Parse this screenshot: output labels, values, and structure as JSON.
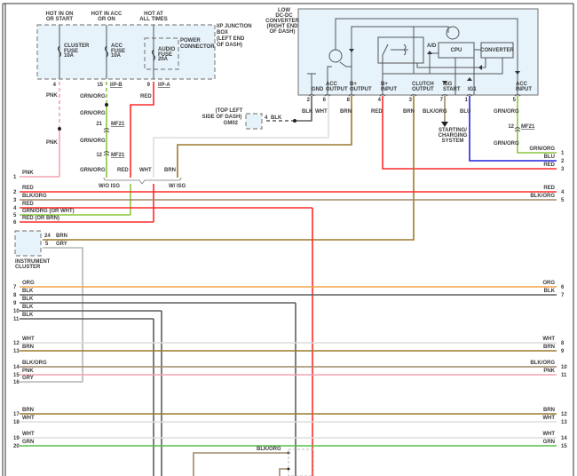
{
  "wire_colors": {
    "RED": "#ff2a2a",
    "PNK": "#f4a3b3",
    "GRN/ORG": "#8cc63f",
    "BRN": "#9c7c2c",
    "BLK": "#5e5e5e",
    "WHT": "#dedede",
    "BLK/ORG": "#a08868",
    "ORG": "#f7a24a",
    "BLU": "#2525e0",
    "GRY": "#b5b5b5",
    "GRN": "#56c04a"
  },
  "junction_box": {
    "label": [
      "I/P JUNCTION",
      "BOX",
      "(LEFT END",
      "OF DASH)"
    ],
    "power_connector": [
      "POWER",
      "CONNECTOR"
    ],
    "fuses": [
      {
        "supply": [
          "HOT IN ON",
          "OR START"
        ],
        "name": [
          "CLUSTER",
          "FUSE",
          "10A"
        ],
        "pin": "4"
      },
      {
        "supply": [
          "HOT IN ACC",
          "OR ON"
        ],
        "name": [
          "ACC",
          "FUSE",
          "10A"
        ],
        "pin": "15",
        "connector": "I/P-B"
      },
      {
        "supply": [
          "HOT AT",
          "ALL TIMES"
        ],
        "name": [
          "AUDIO",
          "FUSE",
          "20A"
        ],
        "pin": "9",
        "connector": "I/P-A"
      }
    ]
  },
  "feed_wires": {
    "pnk": "PNK",
    "grn_org": "GRN/ORG",
    "red": "RED",
    "wht": "WHT",
    "brn": "BRN"
  },
  "inline_connectors": [
    {
      "pin": "21",
      "name": "MF21"
    },
    {
      "pin": "12",
      "name": "MF21"
    },
    {
      "pin": "12",
      "name": "MF21"
    }
  ],
  "variants": {
    "without_isg": "W/O ISG",
    "with_isg": "W/ ISG"
  },
  "ground": {
    "location": [
      "(TOP LEFT",
      "SIDE OF DASH)"
    ],
    "name": "GM02",
    "pin": "4",
    "wire": "BLK"
  },
  "converter": {
    "title": [
      "LOW",
      "DC-DC",
      "CONVERTER",
      "(RIGHT END",
      "OF DASH)"
    ],
    "internal": {
      "ad": "A/D",
      "cpu": "CPU",
      "converter": "CONVERTER"
    },
    "pins": [
      {
        "label": [
          "",
          "GND"
        ],
        "pin": "2",
        "wire": "BLK"
      },
      {
        "label": [
          "ACC",
          "OUTPUT"
        ],
        "pin": "6",
        "wire": "WHT"
      },
      {
        "label": [
          "B+",
          "OUTPUT"
        ],
        "pin": "8",
        "wire": "BRN"
      },
      {
        "label": [
          "B+",
          "INPUT"
        ],
        "pin": "4",
        "wire": "RED"
      },
      {
        "label": [
          "CLUTCH",
          "OUTPUT"
        ],
        "pin": "3",
        "wire": "BRN"
      },
      {
        "label": [
          "ISG",
          "START"
        ],
        "pin": "7",
        "wire": "BLK/ORG"
      },
      {
        "label": [
          "",
          "IG1"
        ],
        "pin": "1",
        "wire": "BLU"
      },
      {
        "label": [
          "ACC",
          "INPUT"
        ],
        "pin": "5",
        "wire": "GRN/ORG"
      }
    ]
  },
  "starting_charging": [
    "STARTING/",
    "CHARGING",
    "SYSTEM"
  ],
  "acc_input_wire_below": "GRN/ORG",
  "instrument_cluster": {
    "label": [
      "INSTRUMENT",
      "CLUSTER"
    ],
    "pins": [
      {
        "pin": "24",
        "wire": "BRN"
      },
      {
        "pin": "5",
        "wire": "GRY"
      }
    ]
  },
  "left_terminals": [
    {
      "num": "1",
      "wire": "PNK"
    },
    {
      "num": "2",
      "wire": "RED"
    },
    {
      "num": "3",
      "wire": "BLK/ORG"
    },
    {
      "num": "4",
      "wire": "RED"
    },
    {
      "num": "5",
      "wire": "GRN/ORG (OR WHT)"
    },
    {
      "num": "6",
      "wire": "RED (OR BRN)"
    },
    {
      "num": "7",
      "wire": "ORG"
    },
    {
      "num": "8",
      "wire": "BLK"
    },
    {
      "num": "9",
      "wire": "BLK"
    },
    {
      "num": "10",
      "wire": "BLK"
    },
    {
      "num": "11",
      "wire": "BLK"
    },
    {
      "num": "12",
      "wire": "WHT"
    },
    {
      "num": "13",
      "wire": "BRN"
    },
    {
      "num": "14",
      "wire": "BLK/ORG"
    },
    {
      "num": "15",
      "wire": "PNK"
    },
    {
      "num": "16",
      "wire": "GRY"
    },
    {
      "num": "17",
      "wire": "BRN"
    },
    {
      "num": "18",
      "wire": "WHT"
    },
    {
      "num": "19",
      "wire": "WHT"
    },
    {
      "num": "20",
      "wire": "GRN"
    }
  ],
  "right_terminals": [
    {
      "num": "1",
      "wire": "GRN/ORG"
    },
    {
      "num": "2",
      "wire": "BLU"
    },
    {
      "num": "3",
      "wire": "RED"
    },
    {
      "num": "4",
      "wire": "RED"
    },
    {
      "num": "5",
      "wire": "BLK/ORG"
    },
    {
      "num": "6",
      "wire": "ORG"
    },
    {
      "num": "7",
      "wire": "BLK"
    },
    {
      "num": "8",
      "wire": "WHT"
    },
    {
      "num": "9",
      "wire": "BRN"
    },
    {
      "num": "10",
      "wire": "BLK/ORG"
    },
    {
      "num": "11",
      "wire": "PNK"
    },
    {
      "num": "12",
      "wire": "BRN"
    },
    {
      "num": "13",
      "wire": "WHT"
    },
    {
      "num": "14",
      "wire": "WHT"
    },
    {
      "num": "15",
      "wire": "GRN"
    }
  ],
  "bottom_label": "BLK/ORG"
}
